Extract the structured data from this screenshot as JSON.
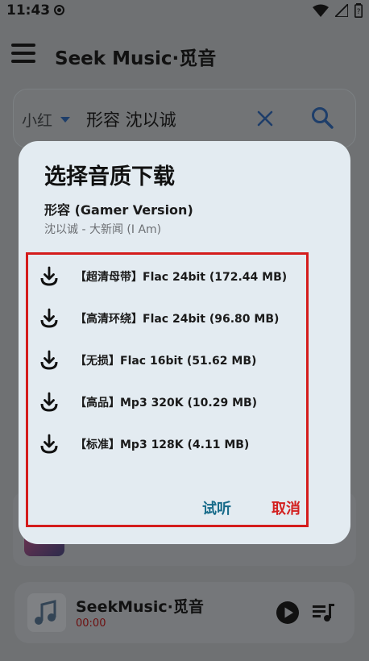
{
  "status_bar": {
    "time": "11:43"
  },
  "app_bar": {
    "title": "Seek Music·觅音"
  },
  "search": {
    "source": "小红",
    "query": "形容 沈以诚"
  },
  "player": {
    "title": "SeekMusic·觅音",
    "time": "00:00"
  },
  "dialog": {
    "title": "选择音质下载",
    "song_name": "形容 (Gamer Version)",
    "song_meta": "沈以诚 - 大新闻 (I Am)",
    "options": [
      {
        "label": "【超清母带】Flac 24bit (172.44 MB)"
      },
      {
        "label": "【高清环绕】Flac 24bit (96.80 MB)"
      },
      {
        "label": "【无损】Flac 16bit (51.62 MB)"
      },
      {
        "label": "【高品】Mp3 320K (10.29 MB)"
      },
      {
        "label": "【标准】Mp3 128K (4.11 MB)"
      }
    ],
    "listen_label": "试听",
    "cancel_label": "取消"
  },
  "colors": {
    "scrim": "#6f7173",
    "dialog_bg": "#e3ebf1",
    "highlight_border": "#d41c1c",
    "listen": "#176b8a",
    "cancel": "#d32020"
  }
}
